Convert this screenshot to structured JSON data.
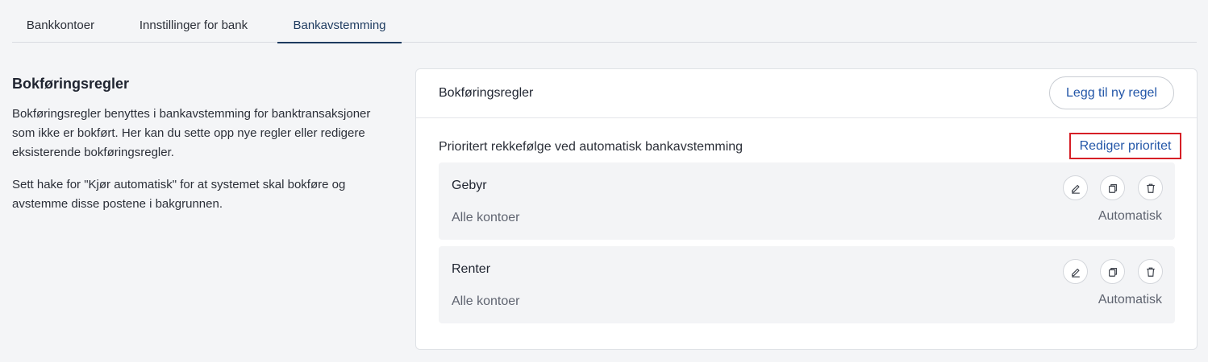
{
  "tabs": [
    {
      "label": "Bankkontoer",
      "active": false
    },
    {
      "label": "Innstillinger for bank",
      "active": false
    },
    {
      "label": "Bankavstemming",
      "active": true
    }
  ],
  "sidebar": {
    "title": "Bokføringsregler",
    "paragraph1": "Bokføringsregler benyttes i bankavstemming for banktransaksjoner som ikke er bokført. Her kan du sette opp nye regler eller redigere eksisterende bokføringsregler.",
    "paragraph2": "Sett hake for \"Kjør automatisk\" for at systemet skal bokføre og avstemme disse postene i bakgrunnen."
  },
  "card": {
    "title": "Bokføringsregler",
    "add_button": "Legg til ny regel",
    "priority_label": "Prioritert rekkefølge ved automatisk bankavstemming",
    "edit_priority": "Rediger prioritet",
    "rules": [
      {
        "name": "Gebyr",
        "accounts": "Alle kontoer",
        "mode": "Automatisk"
      },
      {
        "name": "Renter",
        "accounts": "Alle kontoer",
        "mode": "Automatisk"
      }
    ]
  },
  "icons": [
    "edit-icon",
    "copy-icon",
    "trash-icon"
  ],
  "colors": {
    "accent": "#2457a8",
    "highlight_border": "#d61f26",
    "active_tab": "#1d3a5f"
  }
}
